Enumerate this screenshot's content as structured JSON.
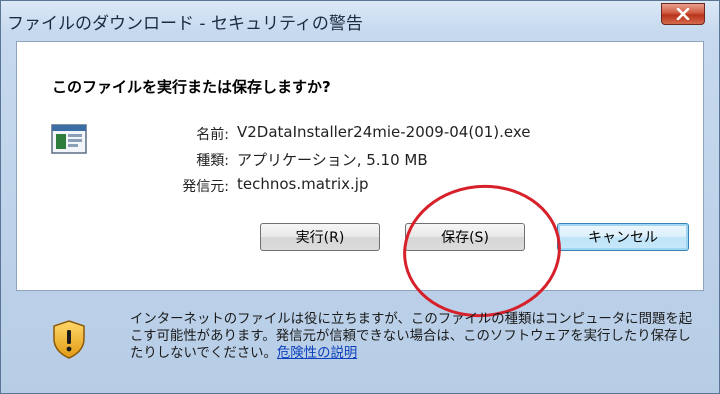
{
  "window": {
    "title": "ファイルのダウンロード - セキュリティの警告",
    "close_symbol": "X"
  },
  "dialog": {
    "heading": "このファイルを実行または保存しますか?",
    "icon": "application-icon",
    "fields": [
      {
        "label": "名前:",
        "value": "V2DataInstaller24mie-2009-04(01).exe"
      },
      {
        "label": "種類:",
        "value": "アプリケーション, 5.10 MB"
      },
      {
        "label": "発信元:",
        "value": "technos.matrix.jp"
      }
    ],
    "buttons": {
      "run_label": "実行(R)",
      "save_label": "保存(S)",
      "cancel_label": "キャンセル"
    }
  },
  "warning": {
    "icon": "shield-warning-icon",
    "text": "インターネットのファイルは役に立ちますが、このファイルの種類はコンピュータに問題を起こす可能性があります。発信元が信頼できない場合は、このソフトウェアを実行したり保存したりしないでください。",
    "link_text": "危険性の説明"
  },
  "annotation_color": "#d6202a"
}
